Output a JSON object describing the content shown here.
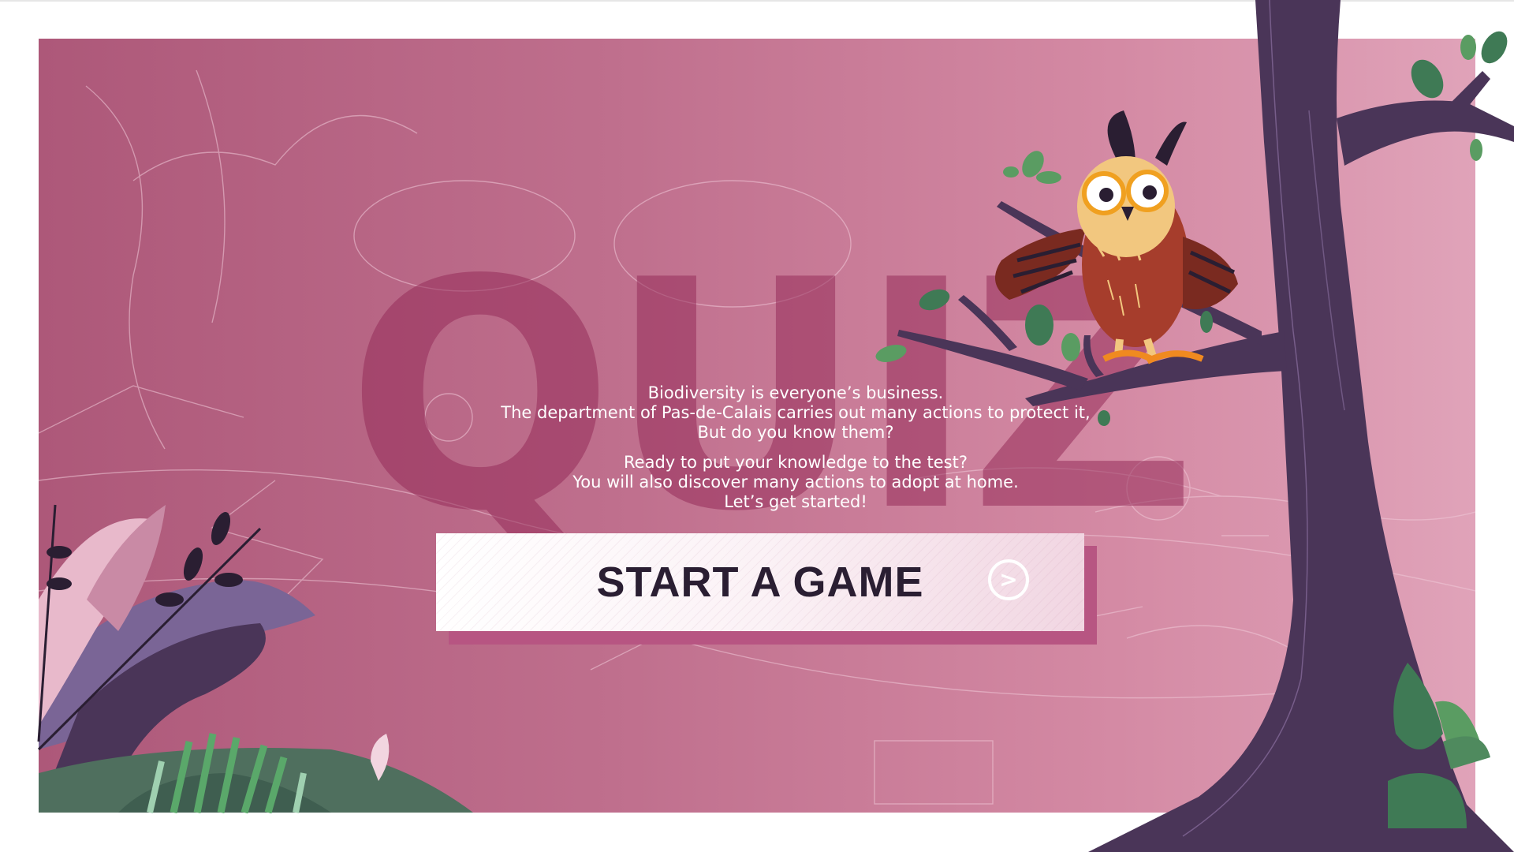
{
  "background_word": "QUIZ",
  "intro": {
    "line1": "Biodiversity is everyone’s business.",
    "line2": "The department of Pas-de-Calais carries out many actions to protect it,",
    "line3": "But do you know them?",
    "line4": "Ready to put your knowledge to the test?",
    "line5": "You will also discover many actions to adopt at home.",
    "line6": "Let’s get started!"
  },
  "cta": {
    "label": "START A GAME",
    "icon": "arrow-right-circle-icon"
  },
  "illustration": {
    "mascot": "owl",
    "elements": [
      "tree",
      "branches",
      "leaves",
      "plants",
      "landscape-line-art"
    ]
  },
  "colors": {
    "stage_start": "#ad5879",
    "stage_end": "#e0a3b9",
    "quiz_word": "#962d5a",
    "button_text": "#2a1e32",
    "tree": "#4a3558",
    "owl_body": "#a63d2c",
    "owl_face": "#f2c77f",
    "leaf": "#3f7a55"
  }
}
